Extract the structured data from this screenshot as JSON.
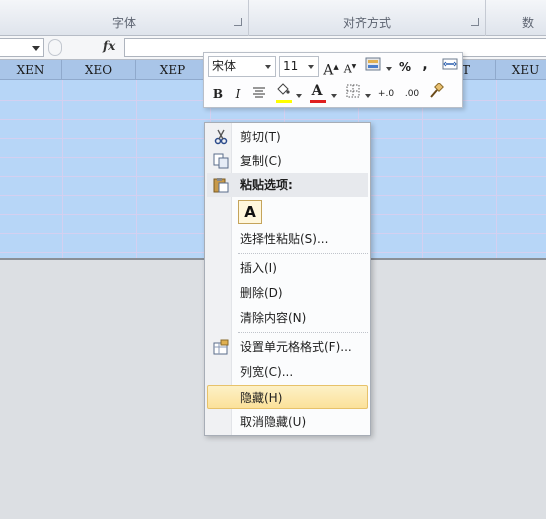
{
  "ribbon": {
    "groups": [
      {
        "label": "字体"
      },
      {
        "label": "对齐方式"
      },
      {
        "label": "数"
      }
    ]
  },
  "formula_bar": {
    "name_box": "",
    "fx_label": "fx",
    "value": ""
  },
  "columns": [
    "XEN",
    "XEO",
    "XEP",
    "",
    "",
    "",
    "T",
    "XEU"
  ],
  "mini_toolbar": {
    "font_name": "宋体",
    "font_size": "11",
    "bold_label": "B",
    "italic_label": "I",
    "font_color_label": "A",
    "percent_label": "%",
    "comma_label": ",",
    "increase_font_label": "A",
    "decrease_font_label": "A",
    "increase_decimal_label": "+.0",
    "decrease_decimal_label": ".00",
    "fill_color": "#ffff00",
    "font_color": "#e02020"
  },
  "context_menu": {
    "items": [
      {
        "label": "剪切(T)",
        "icon": "scissors-icon"
      },
      {
        "label": "复制(C)",
        "icon": "copy-icon"
      },
      {
        "label": "粘贴选项:",
        "icon": "paste-icon"
      },
      {
        "label": "选择性粘贴(S)...",
        "icon": ""
      },
      {
        "label": "插入(I)",
        "icon": ""
      },
      {
        "label": "删除(D)",
        "icon": ""
      },
      {
        "label": "清除内容(N)",
        "icon": ""
      },
      {
        "label": "设置单元格格式(F)...",
        "icon": "format-cells-icon"
      },
      {
        "label": "列宽(C)...",
        "icon": ""
      },
      {
        "label": "隐藏(H)",
        "icon": ""
      },
      {
        "label": "取消隐藏(U)",
        "icon": ""
      }
    ],
    "paste_button_label": "A",
    "highlighted": "隐藏(H)"
  },
  "colors": {
    "selection": "#b7d6f7",
    "header": "#a9c5e8",
    "highlight": "#fbe19a"
  }
}
